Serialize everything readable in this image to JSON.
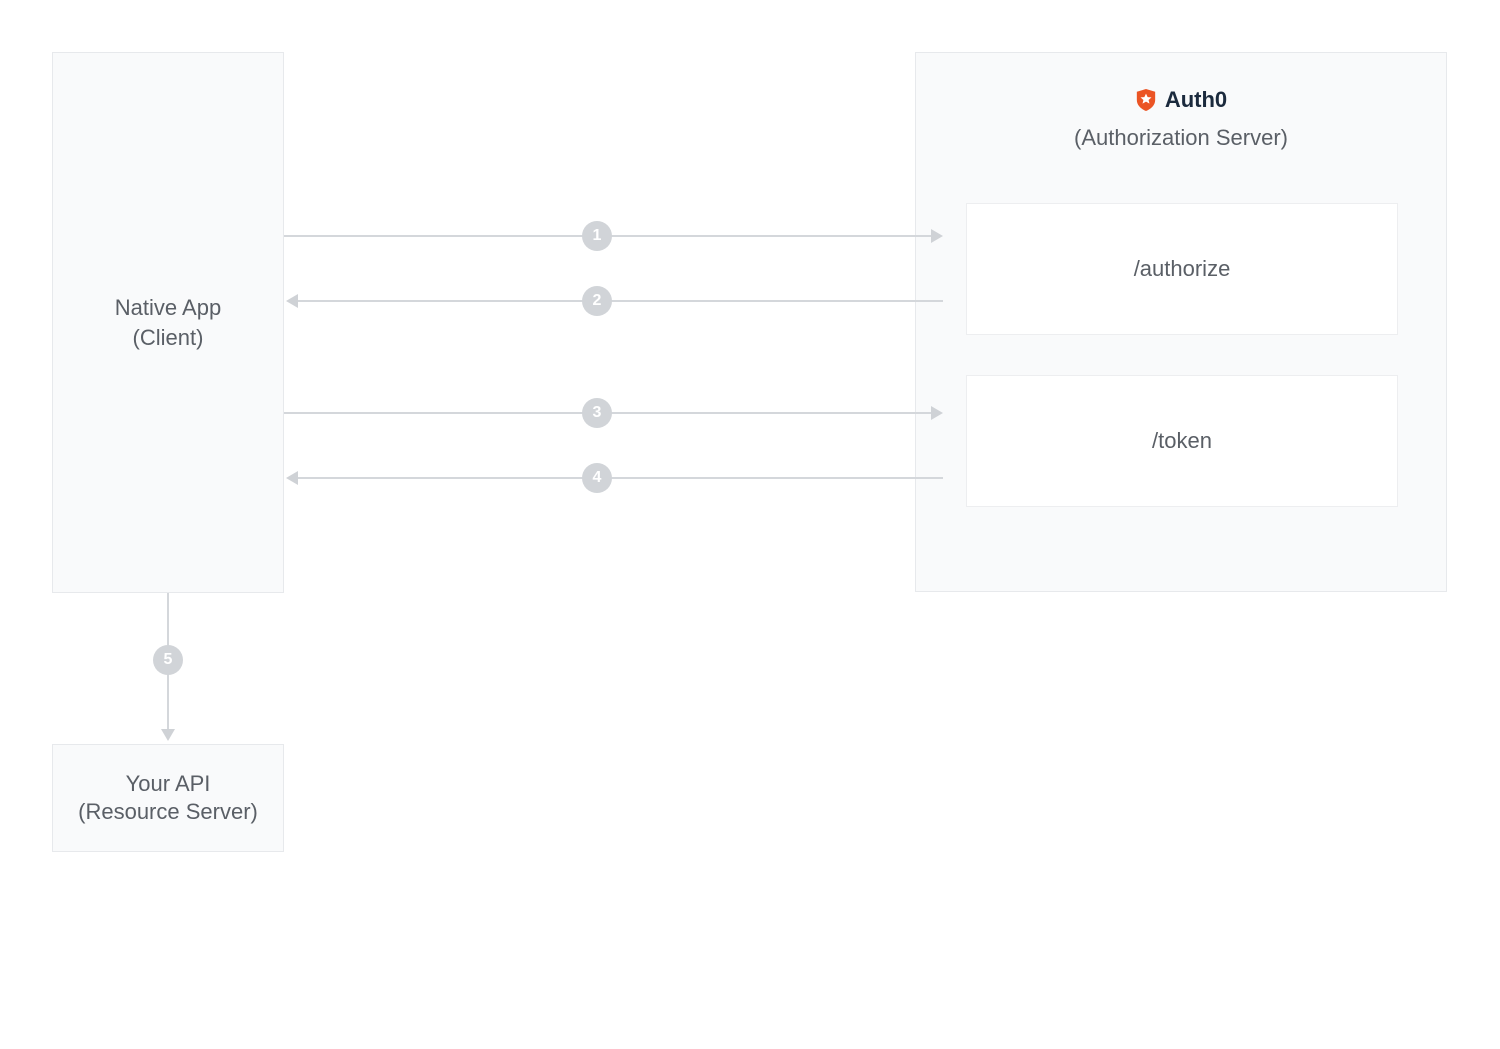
{
  "client": {
    "title": "Native App",
    "subtitle": "(Client)"
  },
  "api": {
    "title": "Your API",
    "subtitle": "(Resource Server)"
  },
  "auth": {
    "brand": "Auth0",
    "subtitle": "(Authorization Server)",
    "endpoints": {
      "authorize": "/authorize",
      "token": "/token"
    }
  },
  "steps": {
    "s1": "1",
    "s2": "2",
    "s3": "3",
    "s4": "4",
    "s5": "5"
  },
  "colors": {
    "brand_orange": "#eb5424"
  }
}
